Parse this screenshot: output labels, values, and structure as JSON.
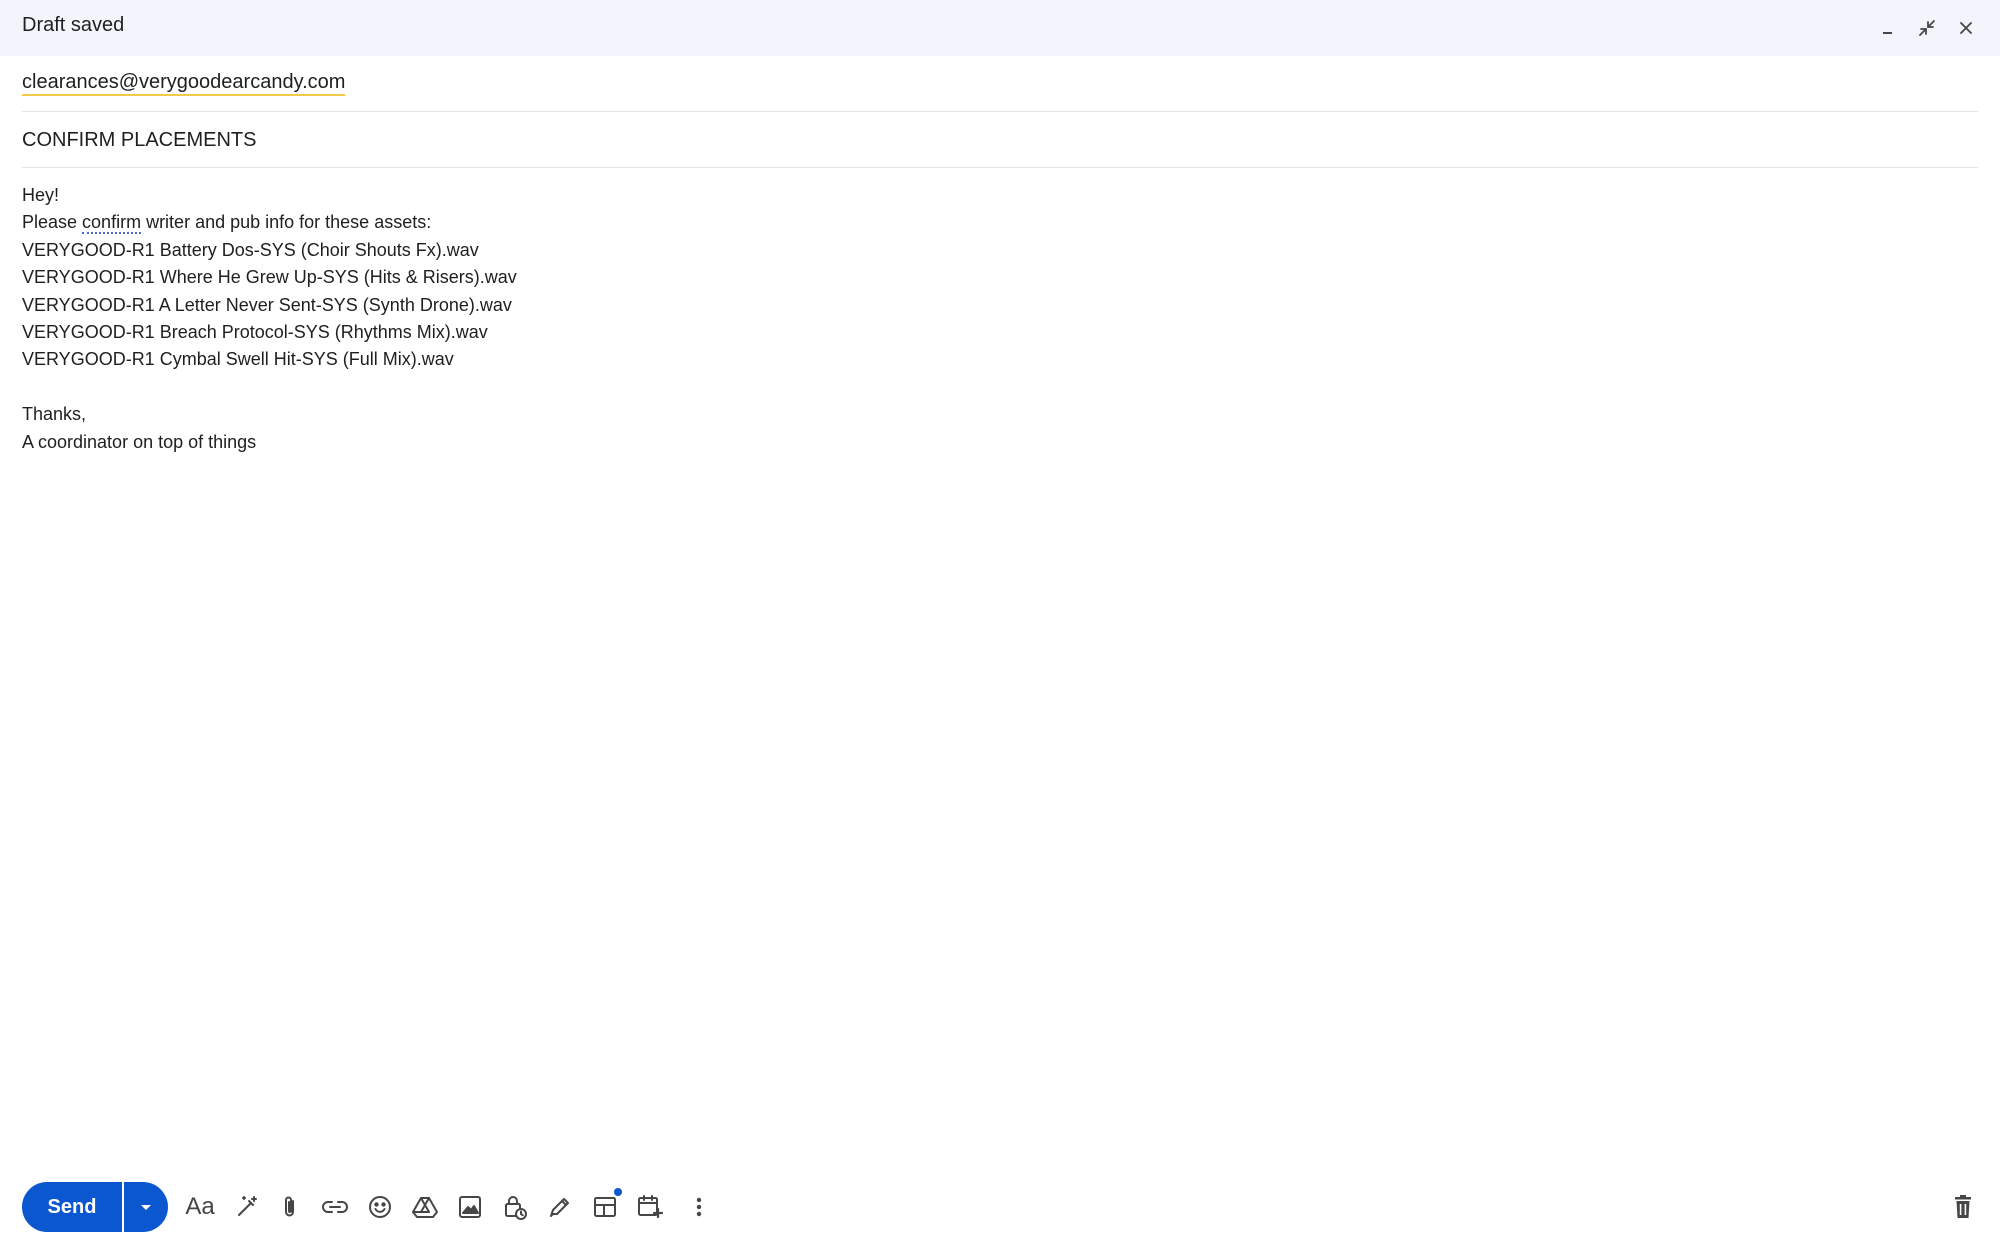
{
  "window": {
    "title": "Draft saved",
    "controls": [
      "minimize-icon",
      "exit-fullscreen-icon",
      "close-icon"
    ]
  },
  "compose": {
    "to_recipient": "clearances@verygoodearcandy.com",
    "subject": "CONFIRM PLACEMENTS",
    "body": {
      "greeting": "Hey!",
      "request_prefix": "Please ",
      "request_flagged_word": "confirm",
      "request_suffix": " writer and pub info for these assets:",
      "assets": [
        "VERYGOOD-R1 Battery Dos-SYS (Choir Shouts Fx).wav",
        "VERYGOOD-R1 Where He Grew Up-SYS (Hits & Risers).wav",
        "VERYGOOD-R1 A Letter Never Sent-SYS (Synth Drone).wav",
        "VERYGOOD-R1 Breach Protocol-SYS (Rhythms Mix).wav",
        "VERYGOOD-R1 Cymbal Swell Hit-SYS (Full Mix).wav"
      ],
      "signoff": "Thanks,",
      "signature": "A coordinator on top of things"
    }
  },
  "toolbar": {
    "send_label": "Send",
    "icons": [
      "formatting-options-icon",
      "ai-write-icon",
      "attach-file-icon",
      "insert-link-icon",
      "insert-emoji-icon",
      "google-drive-icon",
      "insert-photo-icon",
      "confidential-mode-icon",
      "signature-icon",
      "layouts-icon",
      "schedule-event-icon",
      "more-options-icon",
      "discard-draft-icon"
    ],
    "formatting_label": "Aa"
  },
  "colors": {
    "accent": "#0b57d0",
    "titlebar_bg": "#f2f6fc",
    "chip_underline": "#f2c94c"
  }
}
